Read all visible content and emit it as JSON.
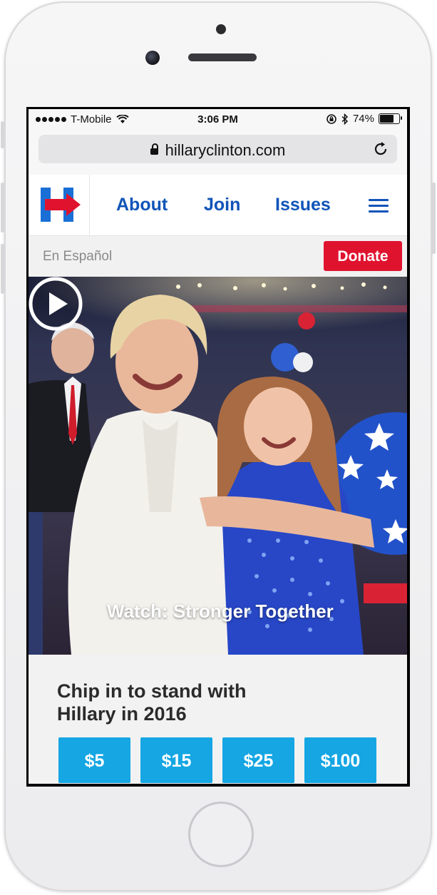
{
  "status_bar": {
    "carrier": "T-Mobile",
    "time": "3:06 PM",
    "battery": "74%",
    "battery_level": 0.74,
    "icons": [
      "signal-dots-icon",
      "wifi-icon",
      "orientation-lock-icon",
      "bluetooth-icon",
      "battery-icon"
    ]
  },
  "browser": {
    "url": "hillaryclinton.com",
    "icons": [
      "lock-icon",
      "reload-icon"
    ]
  },
  "nav": {
    "logo": "H",
    "links": [
      "About",
      "Join",
      "Issues"
    ],
    "menu_icon": "hamburger-menu-icon",
    "accent": "#1054b8"
  },
  "sub_bar": {
    "language_link": "En Español",
    "donate_label": "Donate",
    "donate_color": "#e0132f"
  },
  "hero": {
    "video_label": "Watch: Stronger Together",
    "play_icon": "play-icon"
  },
  "chip_in": {
    "title": "Chip in to stand with Hillary in 2016",
    "amounts": [
      "$5",
      "$15",
      "$25",
      "$100"
    ],
    "button_color": "#15a6e3"
  }
}
